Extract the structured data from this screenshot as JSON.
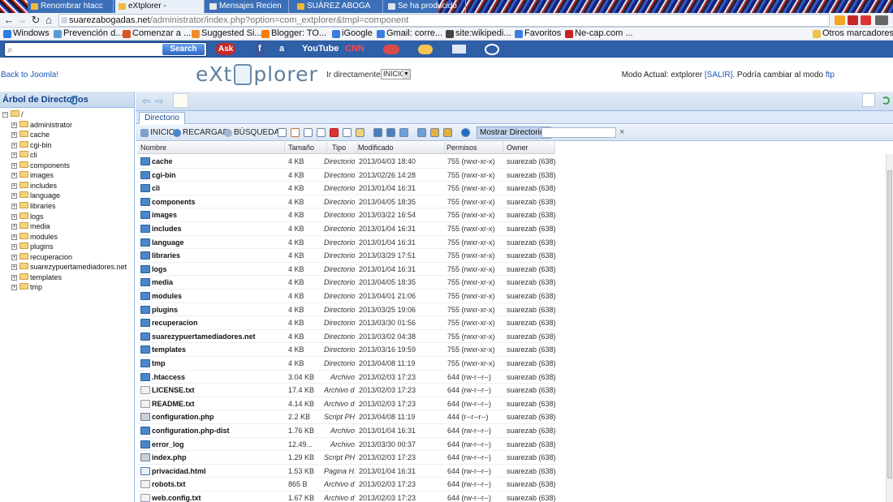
{
  "browser": {
    "tabs": [
      {
        "label": "Renombrar htacc",
        "active": false
      },
      {
        "label": "eXtplorer -",
        "active": true
      },
      {
        "label": "Mensajes Recien",
        "active": false
      },
      {
        "label": "SUÁREZ ABOGA",
        "active": false
      },
      {
        "label": "Se ha producido",
        "active": false
      }
    ],
    "url_domain": "suarezabogadas.net",
    "url_path": "/administrator/index.php?option=com_extplorer&tmpl=component",
    "bookmarks": [
      {
        "label": "Windows",
        "color": "#2b7de0"
      },
      {
        "label": "Prevención d...",
        "color": "#5b9bd5"
      },
      {
        "label": "Comenzar a ...",
        "color": "#d9541e"
      },
      {
        "label": "Suggested Si...",
        "color": "#f28c28"
      },
      {
        "label": "Blogger: TO...",
        "color": "#f57d00"
      },
      {
        "label": "iGoogle",
        "color": "#3b7ddd"
      },
      {
        "label": "Gmail: corre...",
        "color": "#3b7ddd"
      },
      {
        "label": "site:wikipedi...",
        "color": "#444444"
      },
      {
        "label": "Favoritos",
        "color": "#3b7ddd"
      },
      {
        "label": "Ne-cap.com ...",
        "color": "#c22222"
      }
    ],
    "other_bookmarks": "Otros marcadores",
    "search_button": "Search",
    "toolbar_sites": [
      "Ask",
      "f",
      "a",
      "YouTube",
      "CNN"
    ]
  },
  "app": {
    "back_link": "Back to Joomla!",
    "logo": {
      "left": "eXt",
      "right": "plorer"
    },
    "goto_label": "Ir directamente a:",
    "goto_value": "INICIO",
    "mode_prefix": "Modo Actual: extplorer ",
    "mode_logout": "[SALIR]",
    "mode_middle": ". Podría cambiar al modo ",
    "mode_ftp": "ftp"
  },
  "tree": {
    "title": "Árbol de Directorios",
    "root": "/",
    "items": [
      "administrator",
      "cache",
      "cgi-bin",
      "cli",
      "components",
      "images",
      "includes",
      "language",
      "libraries",
      "logs",
      "media",
      "modules",
      "plugins",
      "recuperacion",
      "suarezypuertamediadores.net",
      "templates",
      "tmp"
    ]
  },
  "panel": {
    "tab": "Directorio",
    "toolbar": {
      "home": "INICIO",
      "reload": "RECARGAR",
      "search": "BÚSQUEDA",
      "show_dirs": "Mostrar Directorios",
      "clear": "×"
    },
    "columns": {
      "name": "Nombre",
      "size": "Tamaño",
      "type": "Tipo",
      "modified": "Modificado",
      "perms": "Permisos",
      "owner": "Owner"
    }
  },
  "files": [
    {
      "name": "cache",
      "size": "4 KB",
      "type": "Directorio",
      "modified": "2013/04/03 18:40",
      "perms": "755 (rwxr-xr-x)",
      "owner": "suarezab (638)",
      "icon": "dir"
    },
    {
      "name": "cgi-bin",
      "size": "4 KB",
      "type": "Directorio",
      "modified": "2013/02/26 14:28",
      "perms": "755 (rwxr-xr-x)",
      "owner": "suarezab (638)",
      "icon": "dir"
    },
    {
      "name": "cli",
      "size": "4 KB",
      "type": "Directorio",
      "modified": "2013/01/04 16:31",
      "perms": "755 (rwxr-xr-x)",
      "owner": "suarezab (638)",
      "icon": "dir"
    },
    {
      "name": "components",
      "size": "4 KB",
      "type": "Directorio",
      "modified": "2013/04/05 18:35",
      "perms": "755 (rwxr-xr-x)",
      "owner": "suarezab (638)",
      "icon": "dir"
    },
    {
      "name": "images",
      "size": "4 KB",
      "type": "Directorio",
      "modified": "2013/03/22 16:54",
      "perms": "755 (rwxr-xr-x)",
      "owner": "suarezab (638)",
      "icon": "dir"
    },
    {
      "name": "includes",
      "size": "4 KB",
      "type": "Directorio",
      "modified": "2013/01/04 16:31",
      "perms": "755 (rwxr-xr-x)",
      "owner": "suarezab (638)",
      "icon": "dir"
    },
    {
      "name": "language",
      "size": "4 KB",
      "type": "Directorio",
      "modified": "2013/01/04 16:31",
      "perms": "755 (rwxr-xr-x)",
      "owner": "suarezab (638)",
      "icon": "dir"
    },
    {
      "name": "libraries",
      "size": "4 KB",
      "type": "Directorio",
      "modified": "2013/03/29 17:51",
      "perms": "755 (rwxr-xr-x)",
      "owner": "suarezab (638)",
      "icon": "dir"
    },
    {
      "name": "logs",
      "size": "4 KB",
      "type": "Directorio",
      "modified": "2013/01/04 16:31",
      "perms": "755 (rwxr-xr-x)",
      "owner": "suarezab (638)",
      "icon": "dir"
    },
    {
      "name": "media",
      "size": "4 KB",
      "type": "Directorio",
      "modified": "2013/04/05 18:35",
      "perms": "755 (rwxr-xr-x)",
      "owner": "suarezab (638)",
      "icon": "dir"
    },
    {
      "name": "modules",
      "size": "4 KB",
      "type": "Directorio",
      "modified": "2013/04/01 21:06",
      "perms": "755 (rwxr-xr-x)",
      "owner": "suarezab (638)",
      "icon": "dir"
    },
    {
      "name": "plugins",
      "size": "4 KB",
      "type": "Directorio",
      "modified": "2013/03/25 19:06",
      "perms": "755 (rwxr-xr-x)",
      "owner": "suarezab (638)",
      "icon": "dir"
    },
    {
      "name": "recuperacion",
      "size": "4 KB",
      "type": "Directorio",
      "modified": "2013/03/30 01:56",
      "perms": "755 (rwxr-xr-x)",
      "owner": "suarezab (638)",
      "icon": "dir"
    },
    {
      "name": "suarezypuertamediadores.net",
      "size": "4 KB",
      "type": "Directorio",
      "modified": "2013/03/02 04:38",
      "perms": "755 (rwxr-xr-x)",
      "owner": "suarezab (638)",
      "icon": "dir"
    },
    {
      "name": "templates",
      "size": "4 KB",
      "type": "Directorio",
      "modified": "2013/03/16 19:59",
      "perms": "755 (rwxr-xr-x)",
      "owner": "suarezab (638)",
      "icon": "dir"
    },
    {
      "name": "tmp",
      "size": "4 KB",
      "type": "Directorio",
      "modified": "2013/04/08 11:19",
      "perms": "755 (rwxr-xr-x)",
      "owner": "suarezab (638)",
      "icon": "dir"
    },
    {
      "name": ".htaccess",
      "size": "3.04 KB",
      "type": "Archivo",
      "modified": "2013/02/03 17:23",
      "perms": "644 (rw-r--r--)",
      "owner": "suarezab (638)",
      "icon": "dir"
    },
    {
      "name": "LICENSE.txt",
      "size": "17.4 KB",
      "type": "Archivo d...",
      "modified": "2013/02/03 17:23",
      "perms": "644 (rw-r--r--)",
      "owner": "suarezab (638)",
      "icon": "file"
    },
    {
      "name": "README.txt",
      "size": "4.14 KB",
      "type": "Archivo d...",
      "modified": "2013/02/03 17:23",
      "perms": "644 (rw-r--r--)",
      "owner": "suarezab (638)",
      "icon": "file"
    },
    {
      "name": "configuration.php",
      "size": "2.2 KB",
      "type": "Script PHP",
      "modified": "2013/04/08 11:19",
      "perms": "444 (r--r--r--)",
      "owner": "suarezab (638)",
      "icon": "php"
    },
    {
      "name": "configuration.php-dist",
      "size": "1.76 KB",
      "type": "Archivo",
      "modified": "2013/01/04 16:31",
      "perms": "644 (rw-r--r--)",
      "owner": "suarezab (638)",
      "icon": "dir"
    },
    {
      "name": "error_log",
      "size": "12.49...",
      "type": "Archivo",
      "modified": "2013/03/30 00:37",
      "perms": "644 (rw-r--r--)",
      "owner": "suarezab (638)",
      "icon": "dir"
    },
    {
      "name": "index.php",
      "size": "1.29 KB",
      "type": "Script PHP",
      "modified": "2013/02/03 17:23",
      "perms": "644 (rw-r--r--)",
      "owner": "suarezab (638)",
      "icon": "php"
    },
    {
      "name": "privacidad.html",
      "size": "1.53 KB",
      "type": "Pagina H...",
      "modified": "2013/01/04 16:31",
      "perms": "644 (rw-r--r--)",
      "owner": "suarezab (638)",
      "icon": "html"
    },
    {
      "name": "robots.txt",
      "size": "865 B",
      "type": "Archivo d...",
      "modified": "2013/02/03 17:23",
      "perms": "644 (rw-r--r--)",
      "owner": "suarezab (638)",
      "icon": "file"
    },
    {
      "name": "web.config.txt",
      "size": "1.67 KB",
      "type": "Archivo d...",
      "modified": "2013/02/03 17:23",
      "perms": "644 (rw-r--r--)",
      "owner": "suarezab (638)",
      "icon": "file"
    }
  ]
}
